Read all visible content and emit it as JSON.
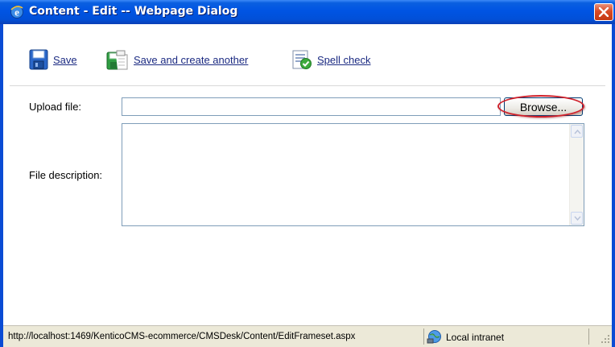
{
  "window": {
    "title": "Content - Edit -- Webpage Dialog"
  },
  "toolbar": {
    "save_label": "Save",
    "save_new_label": "Save and create another",
    "spell_label": "Spell check"
  },
  "form": {
    "upload_label": "Upload file:",
    "upload_value": "",
    "browse_label": "Browse...",
    "description_label": "File description:",
    "description_value": ""
  },
  "statusbar": {
    "url": "http://localhost:1469/KenticoCMS-ecommerce/CMSDesk/Content/EditFrameset.aspx",
    "zone": "Local intranet"
  },
  "colors": {
    "titlebar": "#0054e3",
    "link": "#1b2a82",
    "highlight_ring": "#d0202a",
    "statusbar": "#ece9d8"
  },
  "icons": [
    "ie-icon",
    "close-icon",
    "save-icon",
    "save-create-another-icon",
    "spell-check-icon",
    "local-intranet-icon",
    "resize-grip-icon"
  ]
}
